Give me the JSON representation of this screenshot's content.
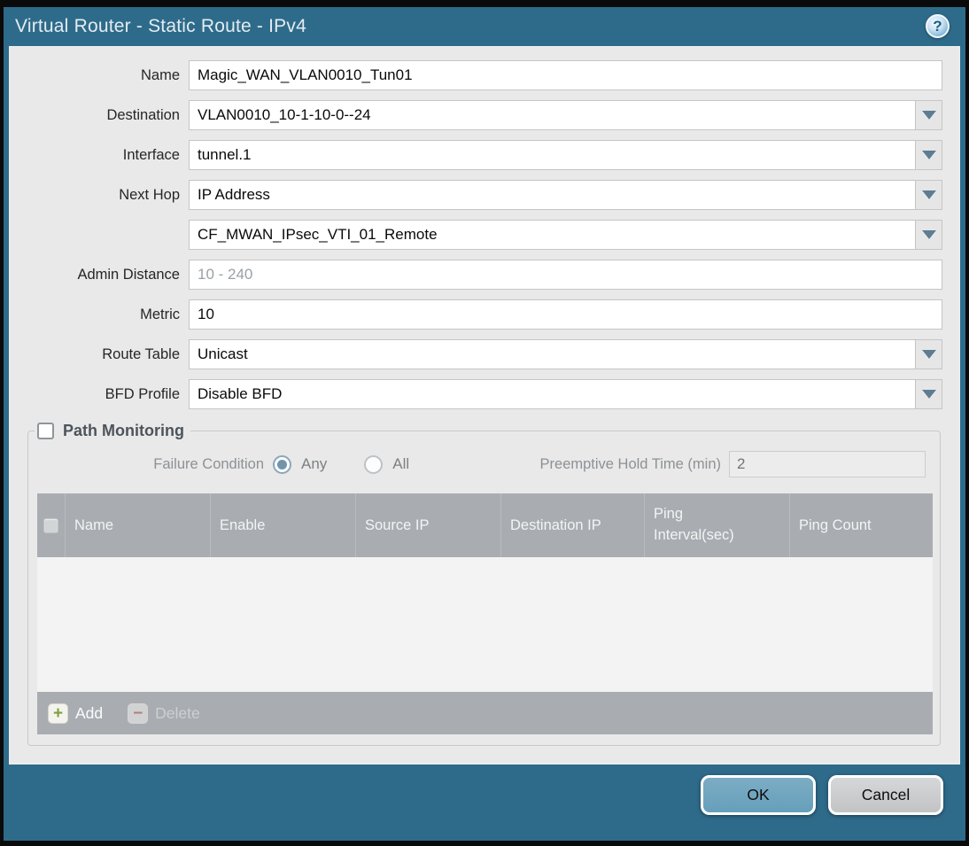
{
  "dialog": {
    "title": "Virtual Router - Static Route - IPv4"
  },
  "icons": {
    "help": "?",
    "plus": "+",
    "minus": "−"
  },
  "form": {
    "fields": [
      {
        "label": "Name",
        "value": "Magic_WAN_VLAN0010_Tun01",
        "type": "text"
      },
      {
        "label": "Destination",
        "value": "VLAN0010_10-1-10-0--24",
        "type": "combo"
      },
      {
        "label": "Interface",
        "value": "tunnel.1",
        "type": "combo"
      },
      {
        "label": "Next Hop",
        "value": "IP Address",
        "type": "combo"
      },
      {
        "label": "",
        "value": "CF_MWAN_IPsec_VTI_01_Remote",
        "type": "combo"
      },
      {
        "label": "Admin Distance",
        "value": "",
        "placeholder": "10 - 240",
        "type": "text"
      },
      {
        "label": "Metric",
        "value": "10",
        "type": "text"
      },
      {
        "label": "Route Table",
        "value": "Unicast",
        "type": "combo"
      },
      {
        "label": "BFD Profile",
        "value": "Disable BFD",
        "type": "combo"
      }
    ]
  },
  "path_monitoring": {
    "title": "Path Monitoring",
    "checkbox_checked": false,
    "failure_condition_label": "Failure Condition",
    "options": [
      {
        "label": "Any",
        "selected": true
      },
      {
        "label": "All",
        "selected": false
      }
    ],
    "preemptive_label": "Preemptive Hold Time (min)",
    "preemptive_value": "2",
    "table": {
      "columns": [
        "Name",
        "Enable",
        "Source IP",
        "Destination IP",
        "Ping Interval(sec)",
        "Ping Count"
      ],
      "rows": [],
      "add_label": "Add",
      "delete_label": "Delete"
    }
  },
  "footer": {
    "ok_label": "OK",
    "cancel_label": "Cancel"
  },
  "colors": {
    "titlebar": "#2e6b8a",
    "panel_background": "#e9e9e9",
    "table_header": "#a9adb1",
    "ok_button": "#6ba3bf",
    "add_icon_green": "#7fa03a",
    "delete_icon_red": "#b28279"
  }
}
